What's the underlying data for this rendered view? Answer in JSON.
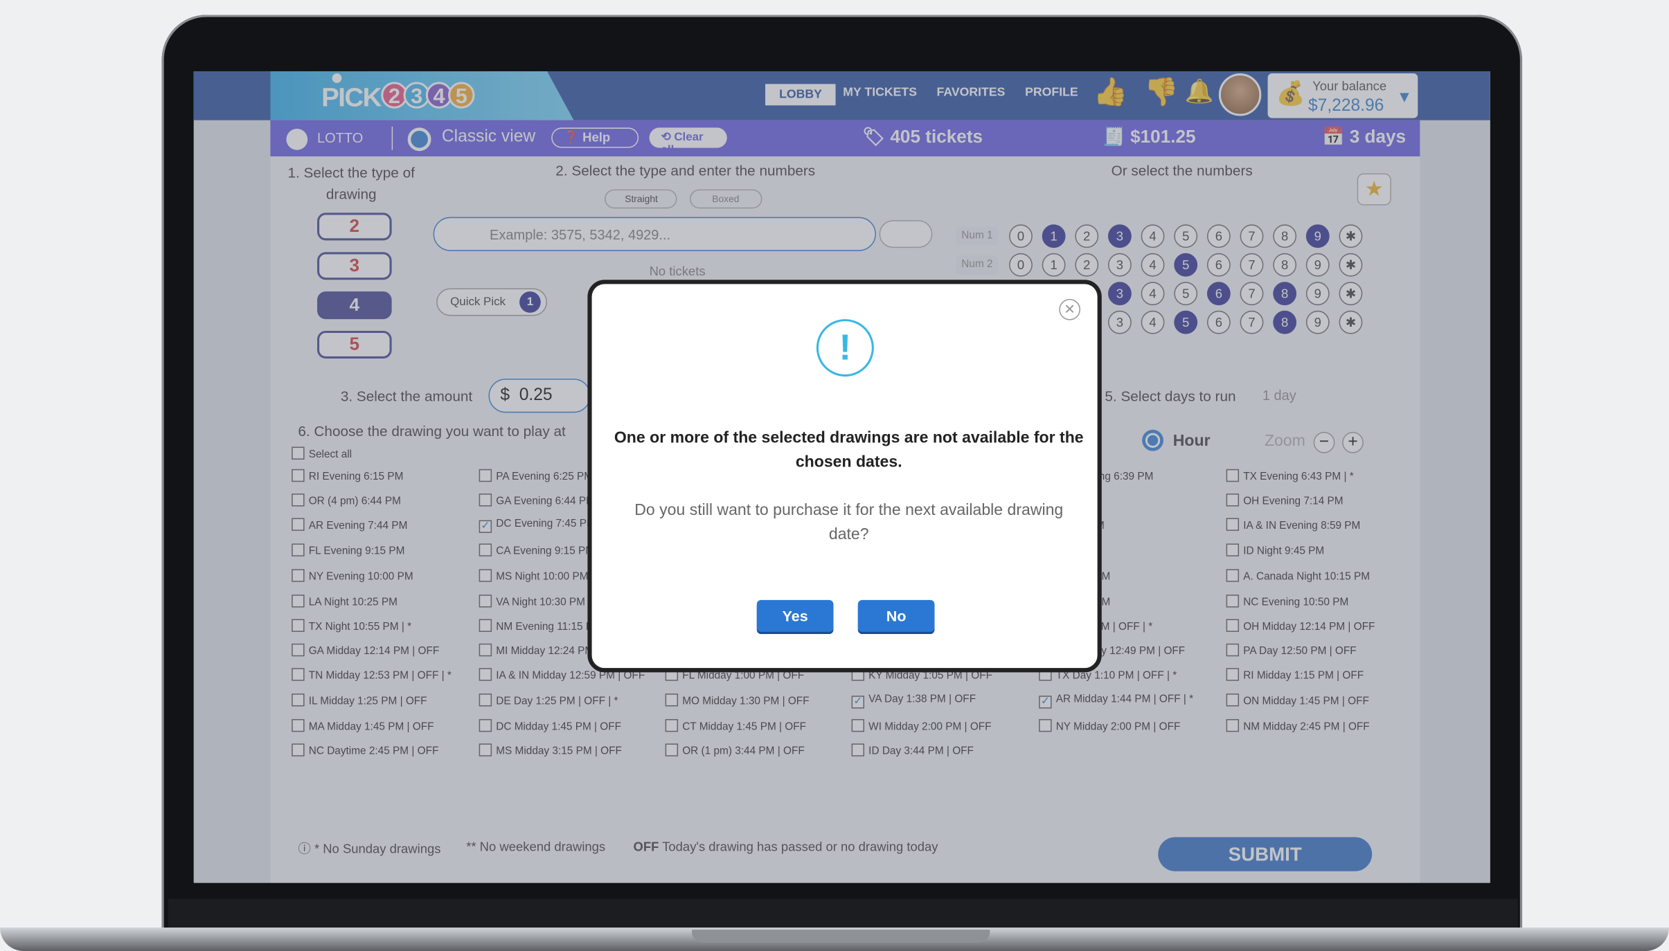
{
  "header": {
    "logo_word": "PICK",
    "logo_digits": [
      "2",
      "3",
      "4",
      "5"
    ],
    "nav": [
      "LOBBY",
      "MY TICKETS",
      "FAVORITES",
      "PROFILE"
    ],
    "balance_label": "Your balance",
    "balance_value": "$7,228.96"
  },
  "subbar": {
    "loto_label": "LOTTO",
    "view_label": "Classic view",
    "help_label": "Help",
    "clear_label": "Clear all",
    "tickets": "405 tickets",
    "amount": "$101.25",
    "days": "3 days"
  },
  "steps": {
    "s1": "1. Select the type of drawing",
    "s2": "2. Select the type and enter the numbers",
    "or": "Or select the numbers",
    "straight": "Straight",
    "boxed": "Boxed",
    "placeholder": "Example: 3575, 5342, 4929...",
    "no_tickets": "No tickets",
    "quick_pick": "Quick Pick",
    "quick_count": "1",
    "s3": "3. Select the amount",
    "amount_currency": "$",
    "amount_value": "0.25",
    "s5": "5. Select days to run",
    "days_value": "1 day",
    "s6": "6. Choose the drawing you want to play at",
    "select_all": "Select all",
    "hour": "Hour",
    "zoom": "Zoom"
  },
  "pick_types": [
    "2",
    "3",
    "4",
    "5"
  ],
  "num_rows": [
    {
      "label": "Num 1",
      "on": [
        1,
        3,
        9
      ]
    },
    {
      "label": "Num 2",
      "on": [
        5
      ]
    },
    {
      "label": "",
      "on": [
        3,
        6,
        8
      ]
    },
    {
      "label": "",
      "on": [
        5,
        8
      ]
    }
  ],
  "drawings": [
    [
      "RI Evening 6:15 PM",
      "OR (4 pm) 6:44 PM",
      "AR Evening 7:44 PM",
      "FL Evening 9:15 PM",
      "NY Evening 10:00 PM",
      "LA Night 10:25 PM",
      "TX Night 10:55 PM | *",
      "GA Midday 12:14 PM | OFF",
      "TN Midday 12:53 PM | OFF | *",
      "IL Midday 1:25 PM | OFF",
      "MA Midday 1:45 PM | OFF",
      "NC Daytime 2:45 PM | OFF"
    ],
    [
      "PA Evening 6:25 PM",
      "GA Evening 6:44 PM",
      "DC Evening 7:45 PM",
      "CA Evening 9:15 PM",
      "MS Night 10:00 PM",
      "VA Night 10:30 PM",
      "NM Evening 11:15 PM",
      "MI Midday 12:24 PM",
      "IA & IN Midday 12:59 PM | OFF",
      "DE Day 1:25 PM | OFF | *",
      "DC Midday 1:45 PM | OFF",
      "MS Midday 3:15 PM | OFF"
    ],
    [
      "",
      "",
      "",
      "",
      "",
      "",
      "",
      "",
      "FL Midday 1:00 PM | OFF",
      "MO Midday 1:30 PM | OFF",
      "CT Midday 1:45 PM | OFF",
      "OR (1 pm) 3:44 PM | OFF"
    ],
    [
      "",
      "",
      "",
      "",
      "",
      "",
      "",
      "",
      "KY Midday 1:05 PM | OFF",
      "VA Day 1:38 PM | OFF",
      "WI Midday 2:00 PM | OFF",
      "ID Day 3:44 PM | OFF"
    ],
    [
      "VT Evening 6:39 PM",
      "7:00 PM",
      "g 8:50 PM",
      "9:44 PM",
      "g 10:15 PM",
      "g 10:45 PM",
      "g 10:44 AM | OFF | *",
      "VT Midday 12:49 PM | OFF",
      "TX Day 1:10 PM | OFF | *",
      "AR Midday 1:44 PM | OFF | *",
      "NY Midday 2:00 PM | OFF",
      ""
    ],
    [
      "TX Evening 6:43 PM | *",
      "OH Evening 7:14 PM",
      "IA & IN Evening 8:59 PM",
      "ID Night 9:45 PM",
      "A. Canada Night 10:15 PM",
      "NC Evening 10:50 PM",
      "OH Midday 12:14 PM | OFF",
      "PA Day 12:50 PM | OFF",
      "RI Midday 1:15 PM | OFF",
      "ON Midday 1:45 PM | OFF",
      "NM Midday 2:45 PM | OFF",
      ""
    ]
  ],
  "checked": [
    "DC Evening 7:45 PM",
    "VA Day 1:38 PM | OFF",
    "AR Midday 1:44 PM | OFF | *"
  ],
  "footer": {
    "sunday": "* No Sunday drawings",
    "weekend": "** No weekend drawings",
    "off_key": "OFF",
    "off_text": "Today's drawing has passed or no drawing today",
    "submit": "SUBMIT"
  },
  "modal": {
    "title": "One or more of the selected drawings are not available for the chosen dates.",
    "text": "Do you still want to purchase it for the next available drawing date?",
    "yes": "Yes",
    "no": "No"
  }
}
